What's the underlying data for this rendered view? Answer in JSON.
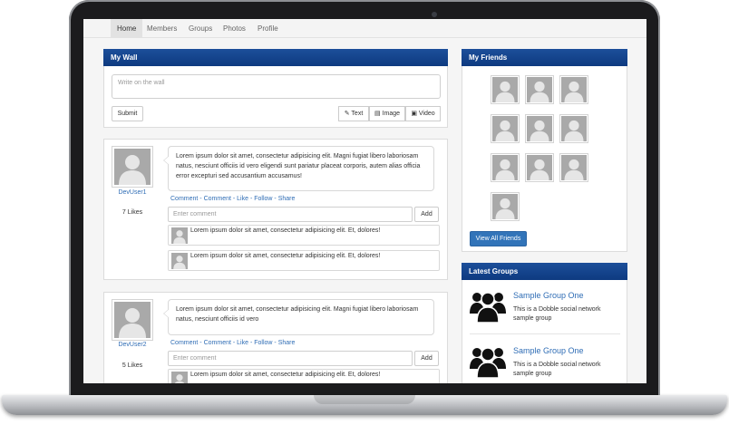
{
  "nav": {
    "items": [
      {
        "label": "Home",
        "active": true
      },
      {
        "label": "Members",
        "active": false
      },
      {
        "label": "Groups",
        "active": false
      },
      {
        "label": "Photos",
        "active": false
      },
      {
        "label": "Profile",
        "active": false
      }
    ]
  },
  "wall": {
    "title": "My Wall",
    "input_placeholder": "Write on the wall",
    "submit_label": "Submit",
    "post_types": [
      "Text",
      "Image",
      "Video"
    ]
  },
  "posts": [
    {
      "user": "DevUser1",
      "likes": "7 Likes",
      "text": "Lorem ipsum dolor sit amet, consectetur adipisicing elit. Magni fugiat libero laboriosam natus, nesciunt officiis id vero eligendi sunt pariatur placeat corporis, autem alias officia error excepturi sed accusantium accusamus!",
      "actions": [
        "Comment",
        "Comment",
        "Like",
        "Follow",
        "Share"
      ],
      "comment_placeholder": "Enter comment",
      "add_label": "Add",
      "comments": [
        "Lorem ipsum dolor sit amet, consectetur adipisicing elit. Et, dolores!",
        "Lorem ipsum dolor sit amet, consectetur adipisicing elit. Et, dolores!"
      ]
    },
    {
      "user": "DevUser2",
      "likes": "5 Likes",
      "text": "Lorem ipsum dolor sit amet, consectetur adipisicing elit. Magni fugiat libero laboriosam natus, nesciunt officiis id vero",
      "actions": [
        "Comment",
        "Comment",
        "Like",
        "Follow",
        "Share"
      ],
      "comment_placeholder": "Enter comment",
      "add_label": "Add",
      "comments": [
        "Lorem ipsum dolor sit amet, consectetur adipisicing elit. Et, dolores!"
      ]
    }
  ],
  "friends": {
    "title": "My Friends",
    "count_shown": 10,
    "view_all_label": "View All Friends"
  },
  "groups": {
    "title": "Latest Groups",
    "items": [
      {
        "name": "Sample Group One",
        "description": "This is a Dobble social network sample group"
      },
      {
        "name": "Sample Group One",
        "description": "This is a Dobble social network sample group"
      }
    ]
  },
  "colors": {
    "panel_header": "#0e3a80",
    "link": "#2f6db5",
    "primary_button": "#3274b9"
  }
}
